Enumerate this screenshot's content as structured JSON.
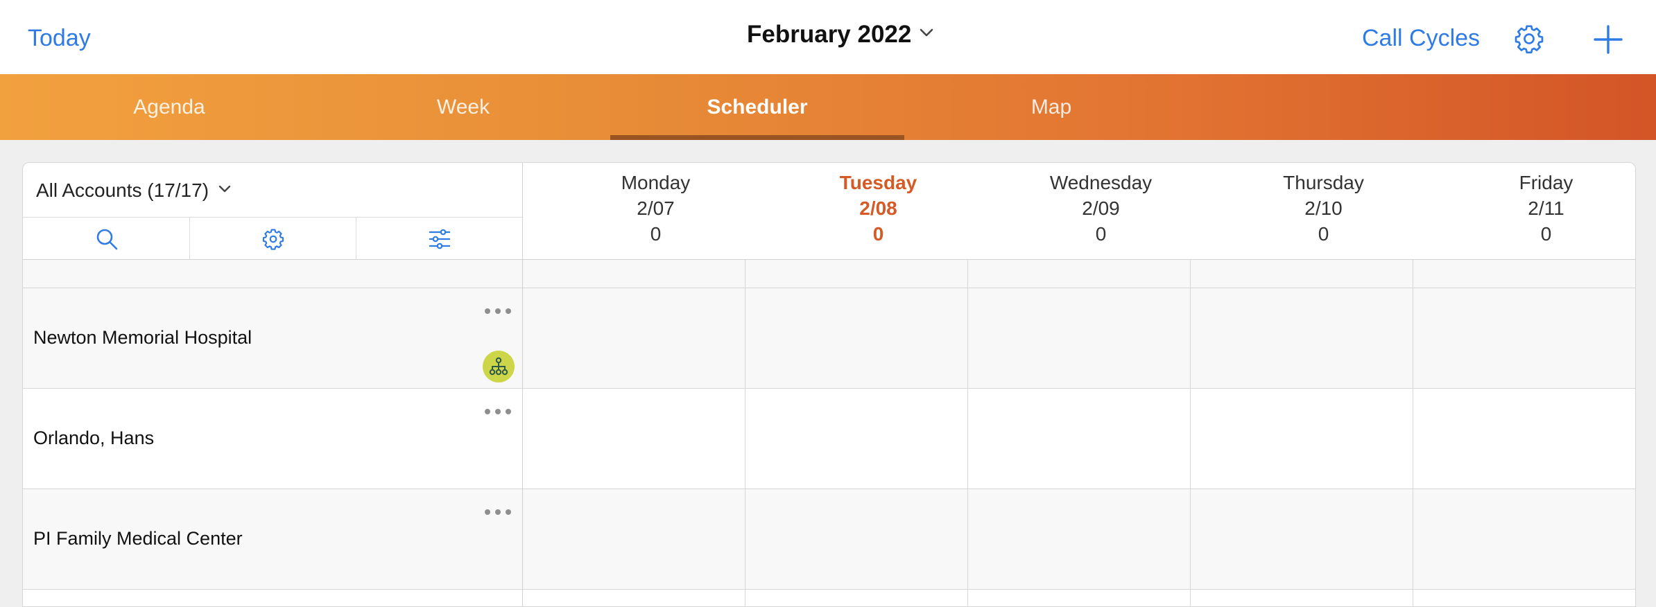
{
  "header": {
    "today_label": "Today",
    "month_label": "February 2022",
    "call_cycles_label": "Call Cycles",
    "icons": [
      "chevron-down-icon",
      "gear-icon",
      "plus-icon"
    ],
    "accent_color": "#2f7be6"
  },
  "tabs": [
    {
      "label": "Agenda",
      "active": false
    },
    {
      "label": "Week",
      "active": false
    },
    {
      "label": "Scheduler",
      "active": true
    },
    {
      "label": "Map",
      "active": false
    }
  ],
  "scheduler": {
    "filter_label": "All Accounts (17/17)",
    "toolbar_icons": [
      "search-icon",
      "gear-icon",
      "sliders-icon"
    ],
    "days": [
      {
        "name": "Monday",
        "date": "2/07",
        "count": "0",
        "today": false
      },
      {
        "name": "Tuesday",
        "date": "2/08",
        "count": "0",
        "today": true
      },
      {
        "name": "Wednesday",
        "date": "2/09",
        "count": "0",
        "today": false
      },
      {
        "name": "Thursday",
        "date": "2/10",
        "count": "0",
        "today": false
      },
      {
        "name": "Friday",
        "date": "2/11",
        "count": "0",
        "today": false
      }
    ],
    "accounts": [
      {
        "name": "Newton Memorial Hospital",
        "has_hierarchy_badge": true
      },
      {
        "name": "Orlando, Hans",
        "has_hierarchy_badge": false
      },
      {
        "name": "PI Family Medical Center",
        "has_hierarchy_badge": false
      }
    ],
    "today_color": "#d65a25",
    "badge_color": "#cdd648"
  }
}
